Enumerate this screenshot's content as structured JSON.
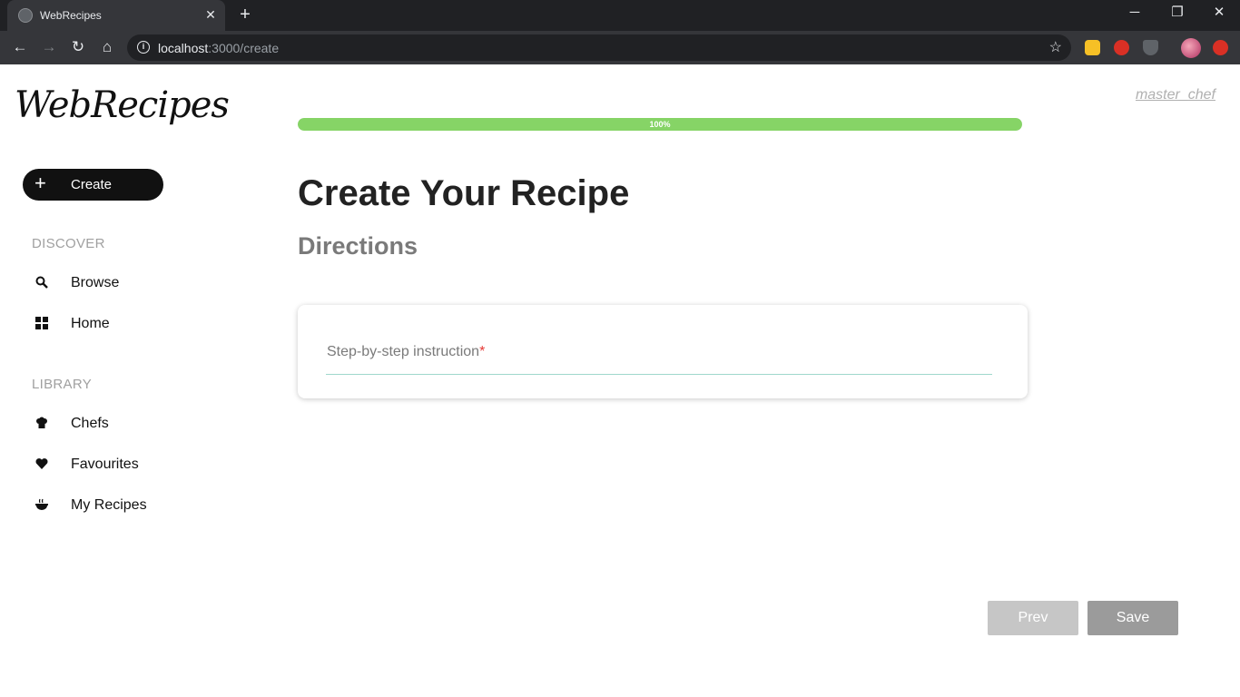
{
  "browser": {
    "tab_title": "WebRecipes",
    "tab_close": "✕",
    "new_tab": "+",
    "url_host": "localhost",
    "url_path": ":3000/create",
    "window_controls": {
      "minimize": "─",
      "restore": "❐",
      "close": "✕"
    }
  },
  "app": {
    "logo": "WebRecipes",
    "user": "master_chef"
  },
  "sidebar": {
    "create_label": "Create",
    "discover_label": "DISCOVER",
    "discover_items": [
      {
        "label": "Browse",
        "icon": "search-icon"
      },
      {
        "label": "Home",
        "icon": "grid-icon"
      }
    ],
    "library_label": "LIBRARY",
    "library_items": [
      {
        "label": "Chefs",
        "icon": "chef-hat-icon"
      },
      {
        "label": "Favourites",
        "icon": "heart-icon"
      },
      {
        "label": "My Recipes",
        "icon": "bowl-icon"
      }
    ]
  },
  "main": {
    "progress_value": 100,
    "progress_text": "100%",
    "title": "Create Your Recipe",
    "subtitle": "Directions",
    "field_label": "Step-by-step instruction",
    "field_required_mark": "*",
    "prev_label": "Prev",
    "save_label": "Save"
  },
  "colors": {
    "progress": "#86d466",
    "create_button": "#111111",
    "required": "#e53935",
    "prev_button": "#c6c6c6",
    "save_button": "#9b9b9b"
  }
}
